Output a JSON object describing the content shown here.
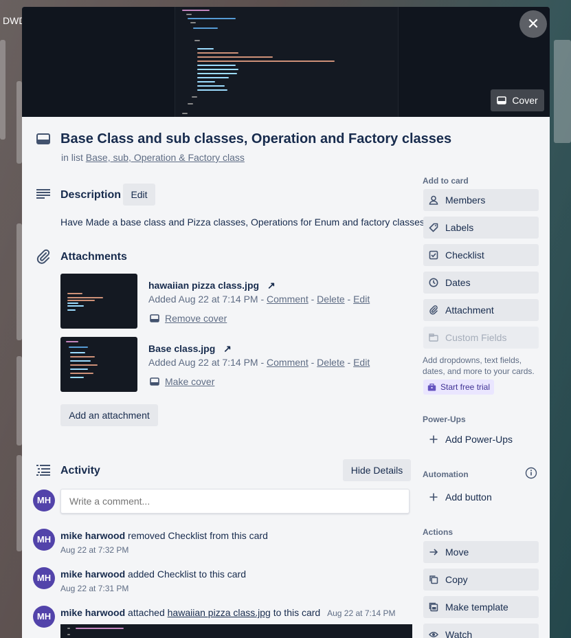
{
  "board": {
    "label": "DWD"
  },
  "card": {
    "cover_label": "Cover",
    "close_label": "✕",
    "title": "Base Class and sub classes, Operation and Factory classes",
    "in_list_prefix": "in list",
    "list_name": "Base, sub, Operation & Factory class"
  },
  "description": {
    "heading": "Description",
    "edit_label": "Edit",
    "text": "Have Made a base class and Pizza classes, Operations for Enum and factory classes."
  },
  "attachments": {
    "heading": "Attachments",
    "items": [
      {
        "name": "hawaiian pizza class.jpg",
        "added": "Added Aug 22 at 7:14 PM",
        "comment": "Comment",
        "delete": "Delete",
        "edit": "Edit",
        "sep": "-",
        "cover_action": "Remove cover"
      },
      {
        "name": "Base class.jpg",
        "added": "Added Aug 22 at 7:14 PM",
        "comment": "Comment",
        "delete": "Delete",
        "edit": "Edit",
        "sep": "-",
        "cover_action": "Make cover"
      }
    ],
    "add_label": "Add an attachment",
    "external_glyph": "↗"
  },
  "activity": {
    "heading": "Activity",
    "hide_details_label": "Hide Details",
    "comment_placeholder": "Write a comment...",
    "avatar_initials": "MH",
    "entries": [
      {
        "user": "mike harwood",
        "text": "removed Checklist from this card",
        "time": "Aug 22 at 7:32 PM"
      },
      {
        "user": "mike harwood",
        "text": "added Checklist to this card",
        "time": "Aug 22 at 7:31 PM"
      },
      {
        "user": "mike harwood",
        "prefix": "attached",
        "link": "hawaiian pizza class.jpg",
        "suffix": "to this card",
        "time": "Aug 22 at 7:14 PM"
      }
    ]
  },
  "sidebar": {
    "add_to_card": "Add to card",
    "buttons": [
      {
        "label": "Members",
        "icon": "person-icon"
      },
      {
        "label": "Labels",
        "icon": "tag-icon"
      },
      {
        "label": "Checklist",
        "icon": "checkbox-icon"
      },
      {
        "label": "Dates",
        "icon": "clock-icon"
      },
      {
        "label": "Attachment",
        "icon": "paperclip-icon"
      },
      {
        "label": "Custom Fields",
        "icon": "custom-fields-icon"
      }
    ],
    "custom_fields_note": "Add dropdowns, text fields, dates, and more to your cards.",
    "start_trial_label": "Start free trial",
    "powerups_heading": "Power-Ups",
    "add_powerups_label": "Add Power-Ups",
    "automation_heading": "Automation",
    "add_button_label": "Add button",
    "actions_heading": "Actions",
    "actions": [
      {
        "label": "Move",
        "icon": "arrow-right-icon"
      },
      {
        "label": "Copy",
        "icon": "copy-icon"
      },
      {
        "label": "Make template",
        "icon": "template-icon"
      },
      {
        "label": "Watch",
        "icon": "eye-icon"
      }
    ]
  },
  "colors": {
    "avatar": "#5243aa",
    "cover_bg": "#10151e",
    "panel_bg": "#f4f5f7",
    "button_bg": "#e6e8ec",
    "trial_bg": "#eae6ff"
  }
}
